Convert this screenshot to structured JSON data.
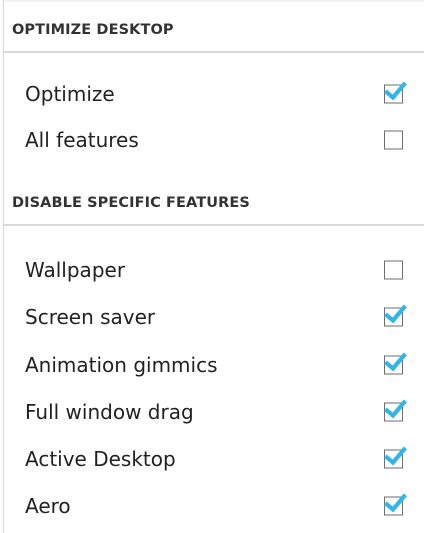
{
  "sections": [
    {
      "title": "OPTIMIZE DESKTOP",
      "items": [
        {
          "label": "Optimize",
          "checked": true
        },
        {
          "label": "All features",
          "checked": false
        }
      ]
    },
    {
      "title": "DISABLE SPECIFIC FEATURES",
      "items": [
        {
          "label": "Wallpaper",
          "checked": false
        },
        {
          "label": "Screen saver",
          "checked": true
        },
        {
          "label": "Animation gimmics",
          "checked": true
        },
        {
          "label": "Full window drag",
          "checked": true
        },
        {
          "label": "Active Desktop",
          "checked": true
        },
        {
          "label": "Aero",
          "checked": true
        }
      ]
    }
  ],
  "icons": {
    "checked": "checkmark-icon",
    "unchecked": "empty-checkbox-icon"
  },
  "colors": {
    "accent": "#33b5e5",
    "checkbox_border": "#6e6e6e",
    "divider": "#d9d9d9",
    "text": "#222222"
  }
}
